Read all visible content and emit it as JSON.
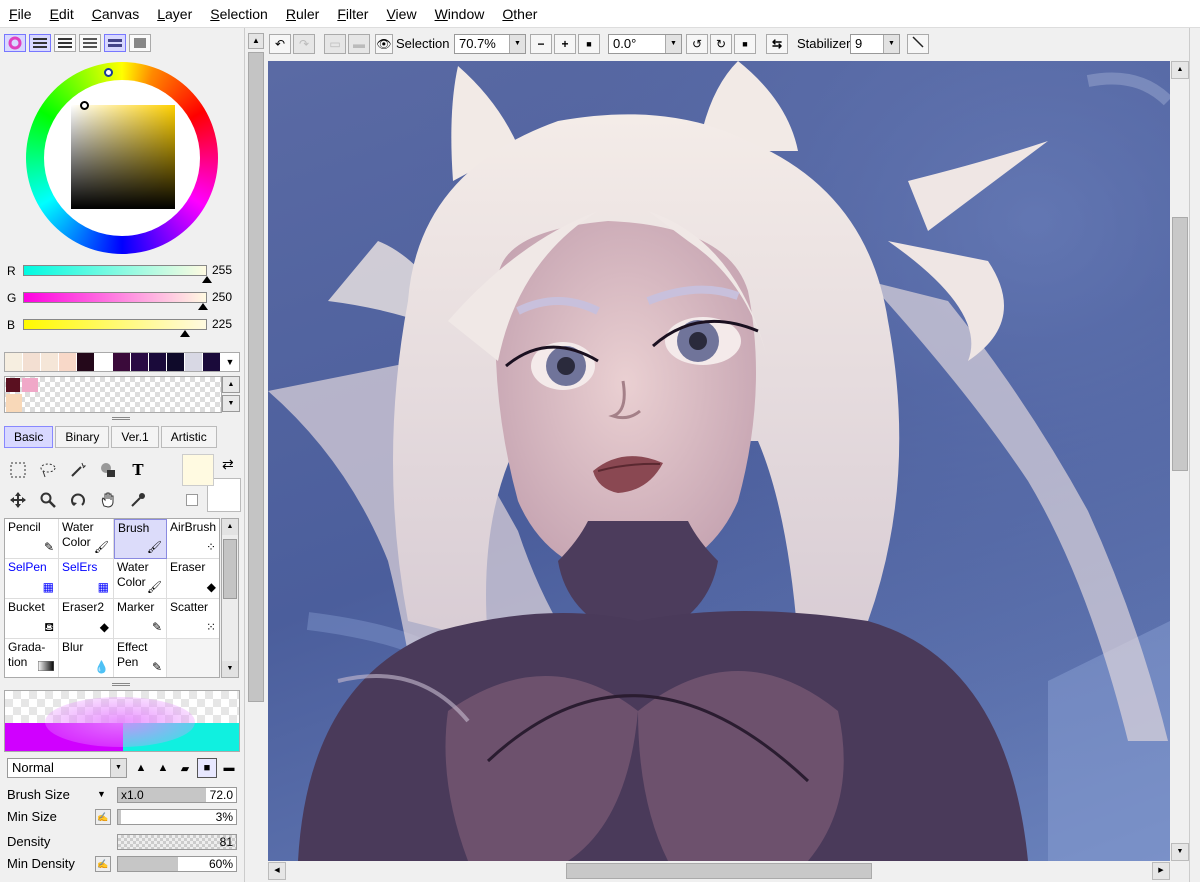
{
  "menu": [
    "File",
    "Edit",
    "Canvas",
    "Layer",
    "Selection",
    "Ruler",
    "Filter",
    "View",
    "Window",
    "Other"
  ],
  "colors": {
    "r": {
      "label": "R",
      "value": "255",
      "level": 1.0
    },
    "g": {
      "label": "G",
      "value": "250",
      "level": 0.98
    },
    "b": {
      "label": "B",
      "value": "225",
      "level": 0.88
    },
    "foreground": "#fffae1",
    "background": "#ffffff"
  },
  "swatches": [
    "#f6eee0",
    "#f3dfd2",
    "#f5e6d8",
    "#f8d8c8",
    "#24081a",
    "#ffffff",
    "#3a0a3a",
    "#2a0a44",
    "#1a0a3a",
    "#0f0a2a",
    "#d8d8e4",
    "#1a0a3a"
  ],
  "color_panel_tabs": [
    "color-wheel",
    "rgb-sliders",
    "hsv-sliders",
    "swatches",
    "palette",
    "scratchpad"
  ],
  "brush_tabs": [
    "Basic",
    "Binary",
    "Ver.1",
    "Artistic"
  ],
  "active_brush_tab": "Basic",
  "tools": [
    "rect-select",
    "lasso",
    "magic-wand",
    "select-pen",
    "text",
    "move",
    "zoom",
    "rotate",
    "hand",
    "eyedropper"
  ],
  "text_tool_glyph": "T",
  "brushes": [
    [
      "Pencil",
      "Water Color",
      "Brush",
      "AirBrush"
    ],
    [
      "SelPen",
      "SelErs",
      "Water Color",
      "Eraser"
    ],
    [
      "Bucket",
      "Eraser2",
      "Marker",
      "Scatter"
    ],
    [
      "Grada- tion",
      "Blur",
      "Effect Pen",
      ""
    ]
  ],
  "active_brush": "Brush",
  "blend_mode": "Normal",
  "brush_props": {
    "brush_size_label": "Brush Size",
    "brush_size_mult": "x1.0",
    "brush_size_value": "72.0",
    "min_size_label": "Min Size",
    "min_size_value": "3%",
    "density_label": "Density",
    "density_value": "81",
    "min_density_label": "Min Density",
    "min_density_value": "60%"
  },
  "toolbar": {
    "selection_label": "Selection",
    "zoom": "70.7%",
    "rotation": "0.0°",
    "stabilizer_label": "Stabilizer",
    "stabilizer": "9"
  }
}
